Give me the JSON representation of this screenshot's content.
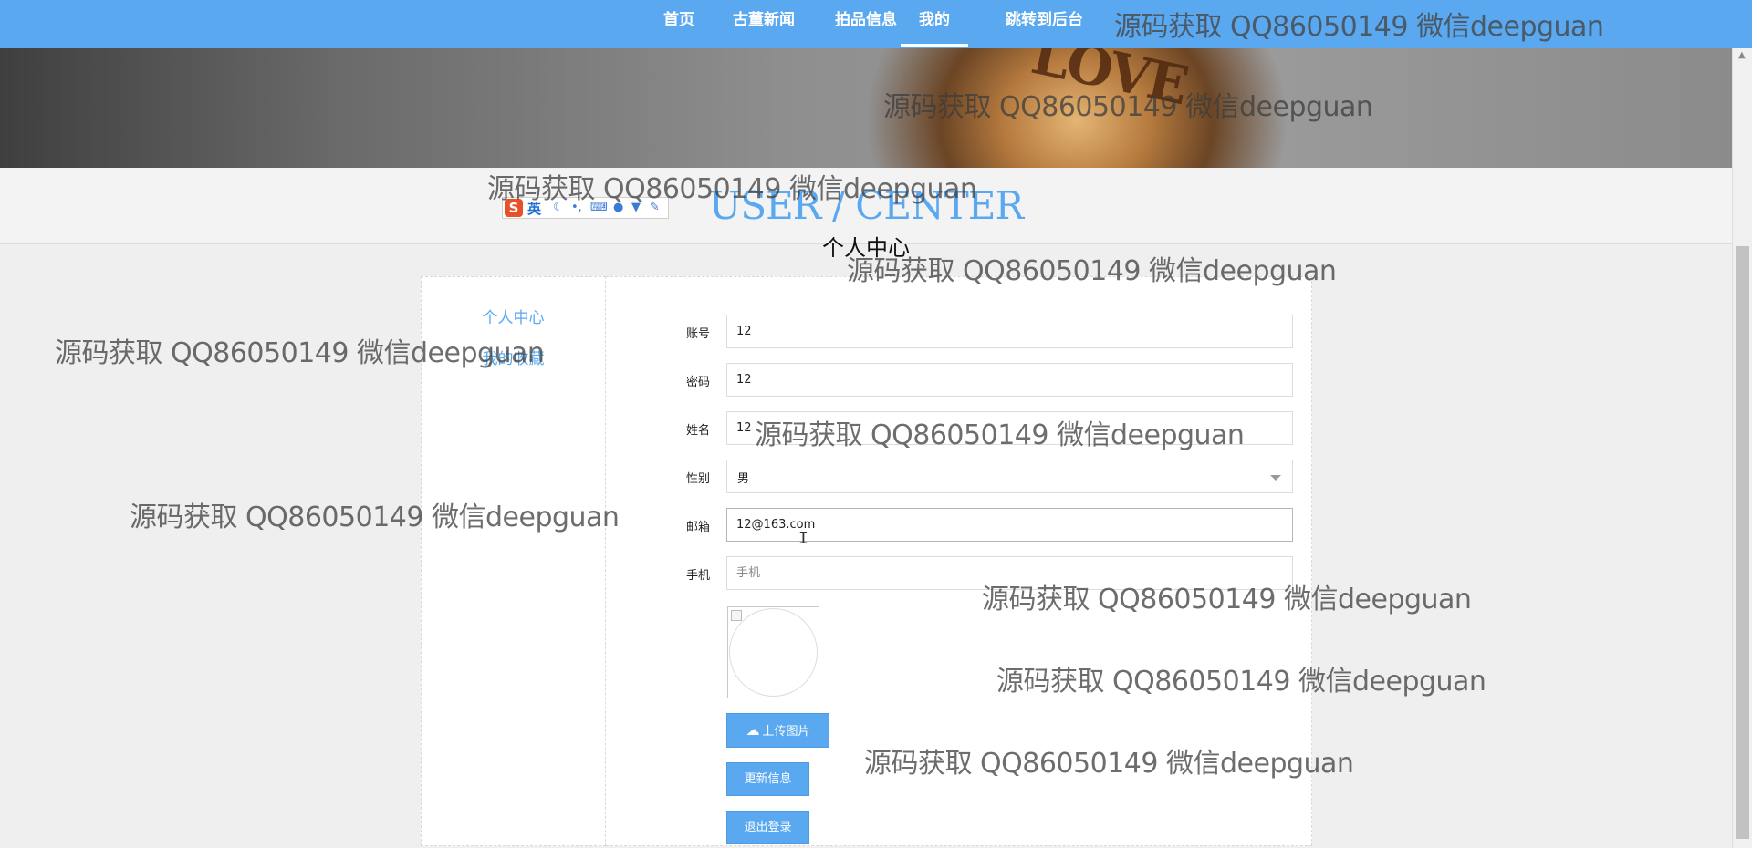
{
  "nav": {
    "items": [
      "首页",
      "古董新闻",
      "拍品信息",
      "我的",
      "跳转到后台"
    ],
    "active_index": 3
  },
  "banner": {
    "trophy_text": "LOVE"
  },
  "header": {
    "title_en": "USER / CENTER",
    "title_cn": "个人中心"
  },
  "ime": {
    "logo": "S",
    "lang": "英"
  },
  "sidebar": {
    "items": [
      "个人中心",
      "我的收藏"
    ]
  },
  "form": {
    "account": {
      "label": "账号",
      "value": "12"
    },
    "password": {
      "label": "密码",
      "value": "12"
    },
    "name": {
      "label": "姓名",
      "value": "12"
    },
    "gender": {
      "label": "性别",
      "value": "男"
    },
    "email": {
      "label": "邮箱",
      "value": "12@163.com"
    },
    "phone": {
      "label": "手机",
      "value": "",
      "placeholder": "手机"
    }
  },
  "buttons": {
    "upload": "上传图片",
    "update": "更新信息",
    "logout": "退出登录"
  },
  "watermark": "源码获取 QQ86050149 微信deepguan",
  "colors": {
    "accent": "#5aa8ef",
    "background": "#efefef"
  }
}
